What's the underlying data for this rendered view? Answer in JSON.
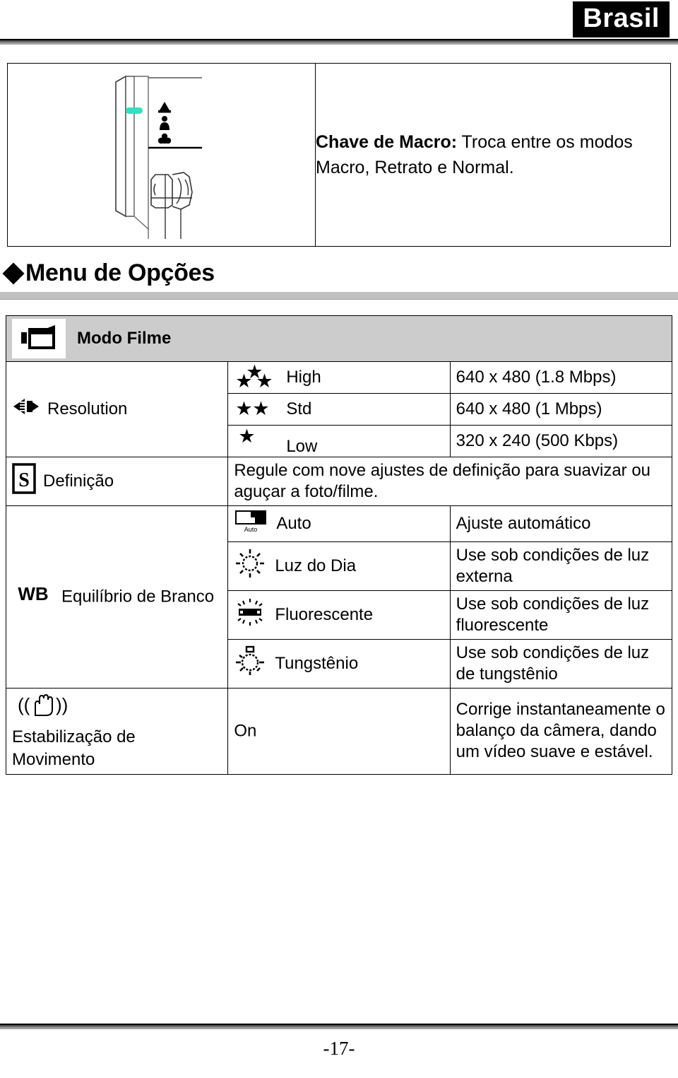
{
  "header": {
    "country_badge": "Brasil"
  },
  "macro_panel": {
    "illustration_name": "camera-macro-switch-illustration",
    "highlight_color": "#33e0c0",
    "label_bold": "Chave de Macro:",
    "text": " Troca entre os modos Macro, Retrato e Normal."
  },
  "section": {
    "bullet": "diamond",
    "title": "Menu de Opções"
  },
  "options_table": {
    "mode_header": {
      "icon": "movie-camera-icon",
      "label": "Modo Filme"
    },
    "rows": [
      {
        "label": "Resolution",
        "icon": "resolution-icon",
        "options": [
          {
            "icon": "three-stars-icon",
            "stars": 3,
            "label": "High",
            "desc": "640 x 480 (1.8 Mbps)"
          },
          {
            "icon": "two-stars-icon",
            "stars": 2,
            "label": "Std",
            "desc": "640 x 480 (1 Mbps)"
          },
          {
            "icon": "one-star-icon",
            "stars": 1,
            "label": "Low",
            "desc": "320 x 240 (500 Kbps)"
          }
        ]
      },
      {
        "label": "Definição",
        "icon": "sharpness-s-icon",
        "full_width_desc": "Regule com nove ajustes de definição para suavizar ou aguçar a foto/filme."
      },
      {
        "label": "Equilíbrio de Branco",
        "icon": "wb-icon",
        "options": [
          {
            "icon": "auto-wb-icon",
            "label": "Auto",
            "desc": "Ajuste automático"
          },
          {
            "icon": "daylight-sun-icon",
            "label": "Luz do Dia",
            "desc": "Use sob condições de luz externa"
          },
          {
            "icon": "fluorescent-lamp-icon",
            "label": "Fluorescente",
            "desc": "Use sob condições de luz fluorescente"
          },
          {
            "icon": "tungsten-bulb-icon",
            "label": "Tungstênio",
            "desc": "Use sob condições de luz de tungstênio"
          }
        ]
      },
      {
        "label": "Estabilização de Movimento",
        "icon": "motion-stabilization-hand-icon",
        "options": [
          {
            "icon": "",
            "label": "On",
            "desc": "Corrige instantaneamente o balanço da câmera, dando um vídeo suave e estável."
          }
        ]
      }
    ]
  },
  "footer": {
    "page_number": "-17-"
  }
}
